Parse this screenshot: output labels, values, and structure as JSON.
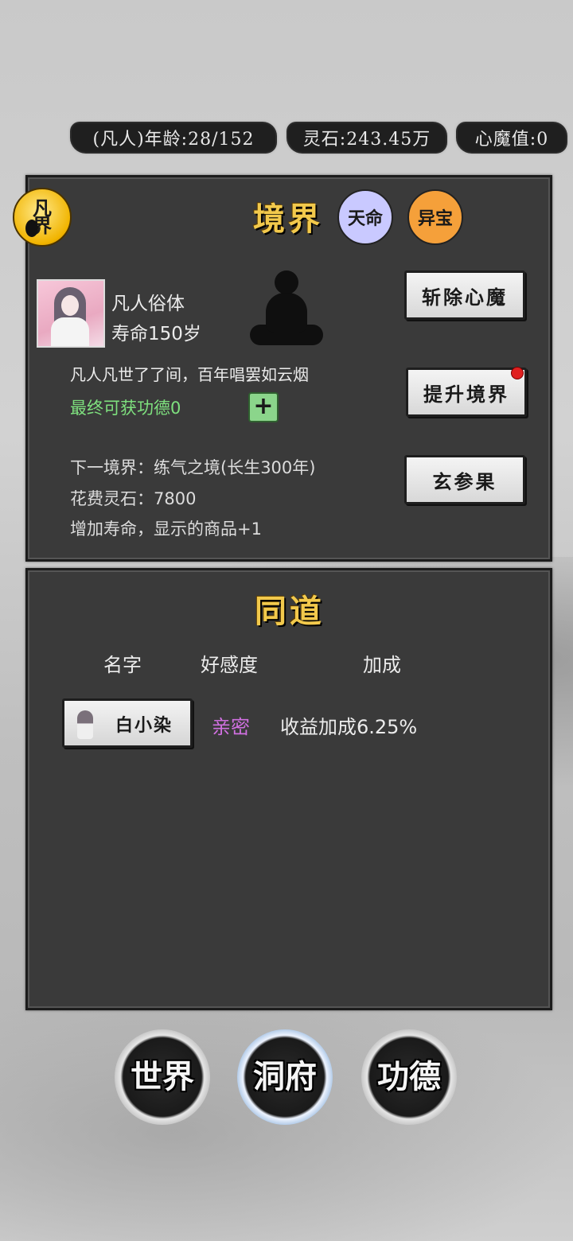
{
  "status_bar": {
    "age": "(凡人)年龄:28/152",
    "spirit_stone": "灵石:243.45万",
    "heart_demon": "心魔值:0"
  },
  "realm_panel": {
    "badge": "凡界",
    "title": "境界",
    "destiny_button": "天命",
    "treasure_button": "异宝",
    "body_name": "凡人俗体",
    "lifespan": "寿命150岁",
    "motto": "凡人凡世了了间，百年唱罢如云烟",
    "merit_gain": "最终可获功德0",
    "plus_button": "+",
    "next_realm": "下一境界：练气之境(长生300年)",
    "cost": "花费灵石：7800",
    "bonus": "增加寿命，显示的商品+1",
    "slay_demon_button": "斩除心魔",
    "ascend_button": "提升境界",
    "ginseng_button": "玄参果"
  },
  "companion_panel": {
    "title": "同道",
    "columns": [
      "名字",
      "好感度",
      "加成"
    ],
    "companions": [
      {
        "name": "白小染",
        "favor": "亲密",
        "bonus": "收益加成6.25%"
      }
    ]
  },
  "bottom_nav": {
    "world": "世界",
    "cave": "洞府",
    "merit": "功德"
  },
  "colors": {
    "title_gold": "#f2c94c",
    "merit_green": "#7ee07e",
    "favor_purple": "#d070e0",
    "destiny_lavender": "#c9c9ff",
    "treasure_orange": "#f5a03a"
  }
}
